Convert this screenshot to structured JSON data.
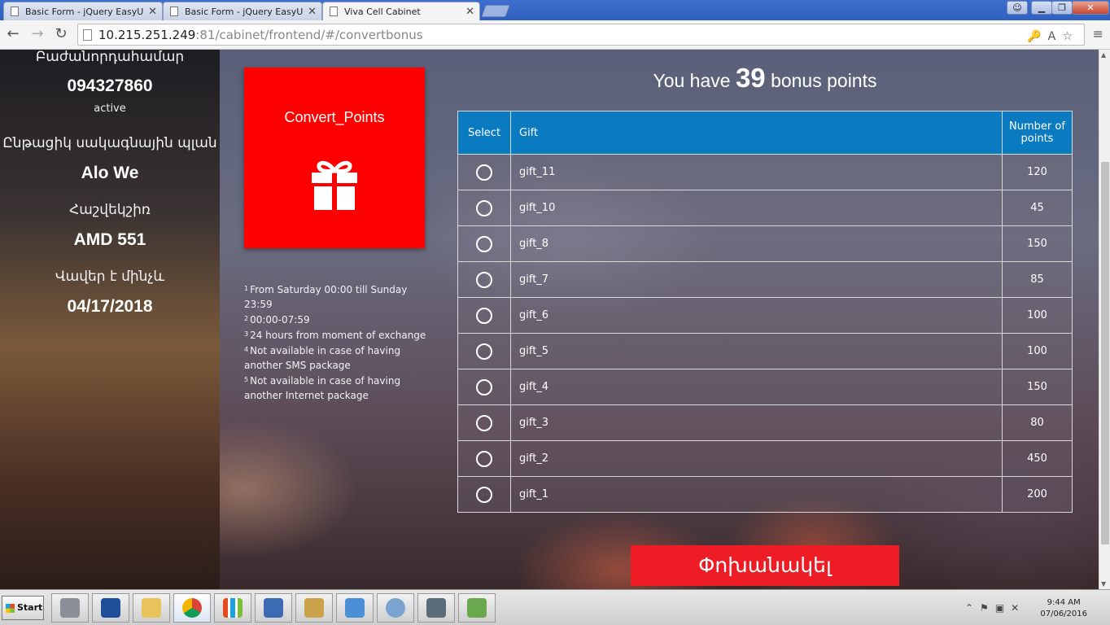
{
  "browser": {
    "tabs": [
      {
        "title": "Basic Form - jQuery EasyUI D"
      },
      {
        "title": "Basic Form - jQuery EasyUI D"
      },
      {
        "title": "Viva Cell Cabinet"
      }
    ],
    "url_host": "10.215.251.249",
    "url_rest": ":81/cabinet/frontend/#/convertbonus"
  },
  "sidebar": {
    "subscriber_label": "Բաժանորդահամար",
    "subscriber_value": "094327860",
    "status": "active",
    "plan_label": "Ընթացիկ սակագնային պլան",
    "plan_value": "Alo We",
    "balance_label": "Հաշվեկշիռ",
    "balance_value": "AMD 551",
    "valid_label": "Վավեր է մինչև",
    "valid_value": "04/17/2018"
  },
  "convert_tile": {
    "label": "Convert_Points",
    "icon": "gift-icon",
    "color": "#fe0000"
  },
  "notes": [
    {
      "num": "1",
      "text": "From Saturday 00:00 till Sunday 23:59"
    },
    {
      "num": "2",
      "text": "00:00-07:59"
    },
    {
      "num": "3",
      "text": "24 hours from moment of exchange"
    },
    {
      "num": "4",
      "text": "Not available in case of having another SMS package"
    },
    {
      "num": "5",
      "text": "Not available in case of having another Internet package"
    }
  ],
  "headline": {
    "before": "You have",
    "points": "39",
    "after": "bonus points"
  },
  "table": {
    "headers": {
      "select": "Select",
      "gift": "Gift",
      "points": "Number of points"
    },
    "header_color": "#0a7ac1",
    "rows": [
      {
        "gift": "gift_11",
        "points": "120"
      },
      {
        "gift": "gift_10",
        "points": "45"
      },
      {
        "gift": "gift_8",
        "points": "150"
      },
      {
        "gift": "gift_7",
        "points": "85"
      },
      {
        "gift": "gift_6",
        "points": "100"
      },
      {
        "gift": "gift_5",
        "points": "100"
      },
      {
        "gift": "gift_4",
        "points": "150"
      },
      {
        "gift": "gift_3",
        "points": "80"
      },
      {
        "gift": "gift_2",
        "points": "450"
      },
      {
        "gift": "gift_1",
        "points": "200"
      }
    ]
  },
  "exchange_button": {
    "label": "Փոխանակել",
    "color": "#ee1c24"
  },
  "taskbar": {
    "start_label": "Start",
    "time": "9:44 AM",
    "date": "07/06/2016"
  }
}
